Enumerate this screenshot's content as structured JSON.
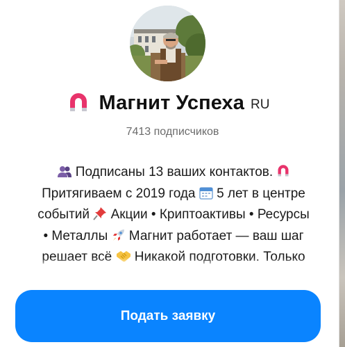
{
  "channel": {
    "title": "Магнит Успеха",
    "title_tag": "RU",
    "subscribers": "7413 подписчиков"
  },
  "description": {
    "lines": [
      [
        "Подписаны 13 ваших контактов."
      ],
      [
        "Притягиваем с 2019 года",
        "5 лет в центре"
      ],
      [
        "событий",
        "Акции • Криптоактивы • Ресурсы"
      ],
      [
        "• Металлы",
        "Магнит работает — ваш шаг"
      ],
      [
        "решает всё",
        "Никакой подготовки. Только"
      ]
    ],
    "icons": [
      "people-icon",
      "magnet-icon",
      "calendar-icon",
      "pushpin-icon",
      "rocket-icon",
      "handshake-icon"
    ]
  },
  "action": {
    "join_label": "Подать заявку"
  },
  "colors": {
    "accent": "#0a84ff",
    "magnet": "#e8336b"
  }
}
